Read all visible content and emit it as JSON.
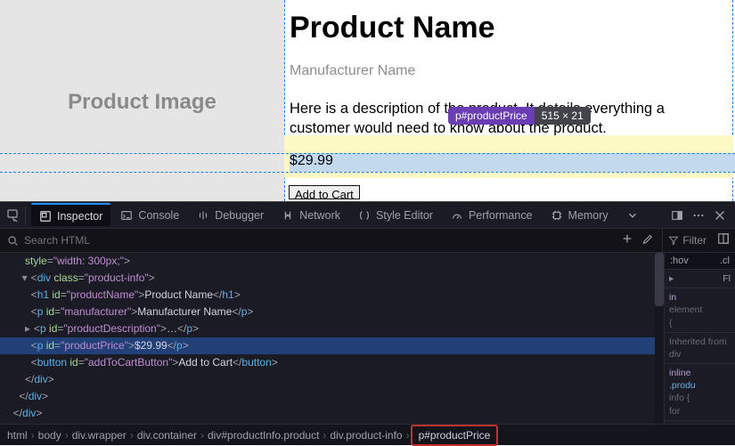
{
  "page": {
    "product_image_label": "Product Image",
    "product_name": "Product Name",
    "manufacturer": "Manufacturer Name",
    "description": "Here is a description of the product. It details everything a customer would need to know about the product.",
    "price": "$29.99",
    "add_to_cart": "Add to Cart"
  },
  "inspector_tip": {
    "selector": "p#productPrice",
    "dims": "515 × 21"
  },
  "devtools": {
    "tabs": [
      "Inspector",
      "Console",
      "Debugger",
      "Network",
      "Style Editor",
      "Performance",
      "Memory"
    ],
    "search_placeholder": "Search HTML",
    "filter_placeholder": "Filter",
    "style_toggles": [
      ":hov",
      ".cl"
    ],
    "styles_panel": {
      "flex_hdr": "Fl",
      "element": "element\n{",
      "inherit": "Inherited from div",
      "inline": "inline",
      "info": "info {",
      "prod": ".produ"
    },
    "breadcrumbs": [
      "html",
      "body",
      "div.wrapper",
      "div.container",
      "div#productInfo.product",
      "div.product-info",
      "p#productPrice"
    ],
    "dom": {
      "l1": {
        "indent": "      ",
        "attr": "style",
        "val": "\"width: 300px;\"",
        "tail": ">"
      },
      "l2": {
        "indent": "     ",
        "arrow": "▾",
        "open": "<div ",
        "attr": "class",
        "val": "\"product-info\"",
        "tail": ">"
      },
      "l3": {
        "indent": "        ",
        "open": "<h1 ",
        "attr": "id",
        "val": "\"productName\"",
        "text": "Product Name",
        "close": "</h1>"
      },
      "l4": {
        "indent": "        ",
        "open": "<p ",
        "attr": "id",
        "val": "\"manufacturer\"",
        "text": "Manufacturer Name",
        "close": "</p>"
      },
      "l5": {
        "indent": "      ",
        "arrow": "▸",
        "open": "<p ",
        "attr": "id",
        "val": "\"productDescription\"",
        "text": "…",
        "close": "</p>"
      },
      "l6": {
        "indent": "        ",
        "open": "<p ",
        "attr": "id",
        "val": "\"productPrice\"",
        "text": "$29.99",
        "close": "</p>"
      },
      "l7": {
        "indent": "        ",
        "open": "<button ",
        "attr": "id",
        "val": "\"addToCartButton\"",
        "text": "Add to Cart",
        "close": "</button>"
      },
      "l8": {
        "indent": "      ",
        "close": "</div>"
      },
      "l9": {
        "indent": "    ",
        "close": "</div>"
      },
      "l10": {
        "indent": "  ",
        "close": "</div>"
      }
    }
  }
}
